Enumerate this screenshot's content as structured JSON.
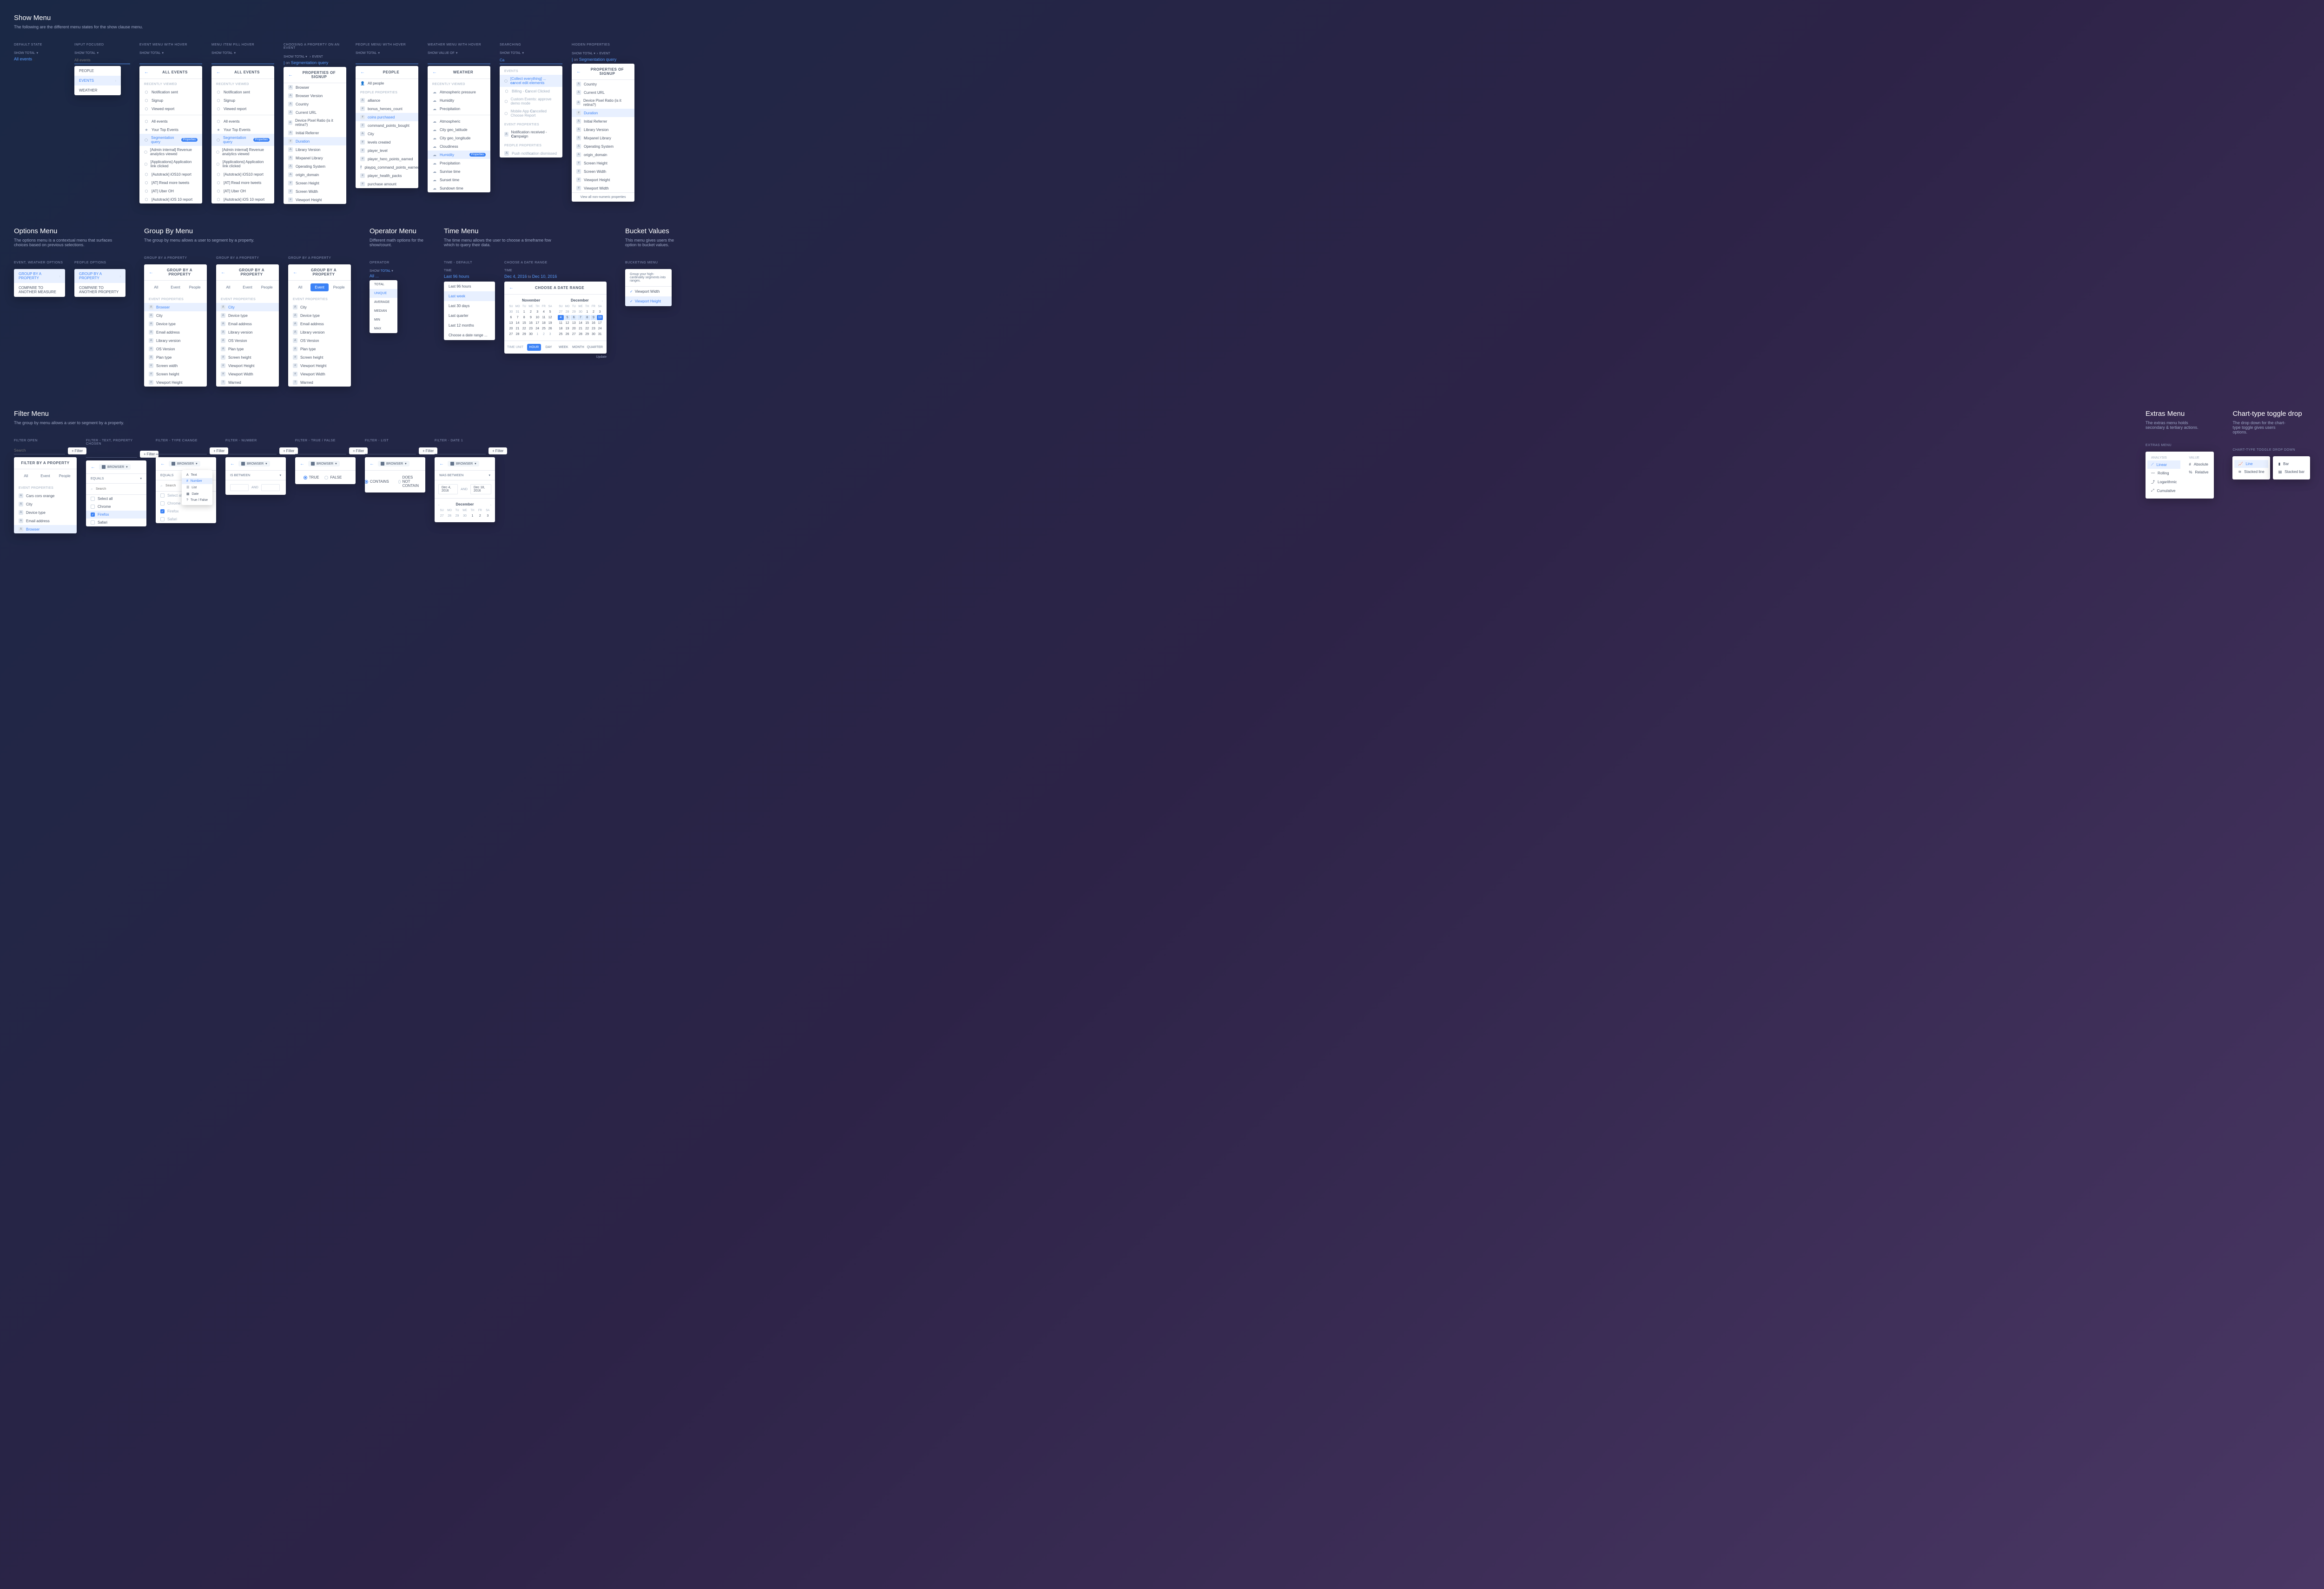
{
  "sections": {
    "show_menu": {
      "title": "Show Menu",
      "desc": "The following are the different menu states for the show clause menu.",
      "variants": {
        "default": "DEFAULT STATE",
        "input_focused": "INPUT FOCUSED",
        "event_hover": "EVENT MENU WITH HOVER",
        "pill_hover": "MENU ITEM PILL HOVER",
        "choosing_prop": "CHOOSING A PROPERTY ON AN EVENT",
        "people_hover": "PEOPLE MENU WITH HOVER",
        "weather_hover": "WEATHER MENU WITH HOVER",
        "searching": "SEARCHING",
        "hidden_props": "HIDDEN PROPERTIES"
      }
    },
    "options_menu": {
      "title": "Options Menu",
      "desc": "The options menu is a contextual menu that surfaces choices based on previous selections.",
      "variants": {
        "event_weather": "EVENT, WEATHER OPTIONS",
        "people": "PEOPLE OPTIONS"
      }
    },
    "group_by": {
      "title": "Group By Menu",
      "desc": "The group by menu allows a user to segment by a property.",
      "variant": "GROUP BY A PROPERTY"
    },
    "operator": {
      "title": "Operator Menu",
      "desc": "Different math options for the show/count.",
      "variant": "OPERATOR"
    },
    "time": {
      "title": "Time Menu",
      "desc": "The time menu allows the user to choose a timeframe fow which to query their data.",
      "variants": {
        "default": "TIME - DEFAULT",
        "range": "CHOOSE A DATE RANGE"
      }
    },
    "bucket": {
      "title": "Bucket Values",
      "desc": "This menu gives users the option to bucket values.",
      "variant": "BUCKETING MENU"
    },
    "filter": {
      "title": "Filter Menu",
      "desc": "The group by menu allows a user to segment by a property.",
      "variants": {
        "open": "FILTER OPEN",
        "text": "FILTER - TEXT, PROPERTY CHOSEN",
        "type_change": "FILTER - TYPE CHANGE",
        "number": "FILTER - NUMBER",
        "bool": "FILTER - TRUE / FALSE",
        "list": "FILTER - LIST",
        "date": "FILTER - DATE 1"
      }
    },
    "extras": {
      "title": "Extras Menu",
      "desc": "The extras menu holds secondary & tertiary actions.",
      "variant": "EXTRAS MENU"
    },
    "chart_toggle": {
      "title": "Chart-type toggle drop",
      "desc": "The drop down for the chart-type toggle gives users options.",
      "variant": "CHART-TYPE TOGGLE DROP DOWN"
    }
  },
  "common": {
    "show_total": "SHOW TOTAL",
    "all_events_link": "All events",
    "search_placeholder": "Search",
    "filter_btn": "Filter",
    "back": "←",
    "event_crumb": "EVENT",
    "on": "on",
    "seg_query": "Segmentation query"
  },
  "people_events_weather": {
    "people": "PEOPLE",
    "events": "EVENTS",
    "weather": "WEATHER"
  },
  "all_events_panel": {
    "title": "ALL EVENTS",
    "recently_viewed": "RECENTLY VIEWED",
    "recent": [
      "Notification sent",
      "Signup",
      "Viewed report"
    ],
    "all_events": "All events",
    "top_events": "Your Top Events",
    "items": [
      "Segmentation query",
      "[Admin internal] Revenue analytics viewed",
      "[Applications] Application link clicked",
      "[Autotrack] iOS10 report",
      "[AT] Read more tweets",
      "[AT] Uber OH",
      "[Autotrack] iOS 10 report"
    ],
    "properties_badge": "Properties"
  },
  "properties_signup": {
    "title": "PROPERTIES OF SIGNUP",
    "items": [
      "Browser",
      "Browser Version",
      "Country",
      "Current URL",
      "Device Pixel Ratio (is it retina?)",
      "Initial Referrer",
      "Duration",
      "Library Version",
      "Mixpanel Library",
      "Operating System",
      "origin_domain",
      "Screen Height",
      "Screen Width",
      "Viewport Height"
    ]
  },
  "people_panel": {
    "title": "PEOPLE",
    "all_people": "All people",
    "section": "PEOPLE PROPERTIES",
    "items": [
      "alliance",
      "bonus_heroes_count",
      "coins purchased",
      "command_points_bought",
      "City",
      "levels created",
      "player_level",
      "player_hero_points_earned",
      "playpq_command_points_earned",
      "player_health_packs",
      "purchase amount"
    ]
  },
  "weather_panel": {
    "title": "WEATHER",
    "show_value_of": "SHOW VALUE OF",
    "recently_viewed": "RECENTLY VIEWED",
    "recent": [
      "Atmospheric pressure",
      "Humidity",
      "Precipitation"
    ],
    "items": [
      "Atmospheric",
      "City geo_latitude",
      "City geo_longitude",
      "Cloudiness",
      "Humidity",
      "Precipitation",
      "Sunrise time",
      "Sunset time",
      "Sundown time"
    ],
    "properties_badge": "Properties"
  },
  "searching_panel": {
    "search_val": "Ca",
    "events_label": "EVENTS",
    "events": [
      {
        "pre": "[Collect everything] ... ",
        "match": "ca",
        "post": "ncel edit elements"
      },
      {
        "pre": "Billing - ",
        "match": "Ca",
        "post": "ncel Clicked",
        "muted": true
      },
      {
        "pre": "Custom Events: ap",
        "match": "",
        "post": "prove demo mode",
        "muted": true
      },
      {
        "pre": "Mobile App ",
        "match": "Ca",
        "post": "ncelled Choose Report",
        "muted": true
      }
    ],
    "event_props_label": "EVENT PROPERTIES",
    "event_props": [
      {
        "pre": "Notification received - ",
        "match": "Ca",
        "post": "mpaign"
      }
    ],
    "people_props_label": "PEOPLE PROPERTIES",
    "people_props": [
      {
        "pre": "Push notifi",
        "match": "ca",
        "post": "tion dismissed",
        "muted": true
      }
    ]
  },
  "hidden_props": {
    "title": "PROPERTIES OF SIGNUP",
    "items": [
      "Country",
      "Current URL",
      "Device Pixel Ratio (is it retina?)",
      "Duration",
      "Initial Referrer",
      "Library Version",
      "Mixpanel Library",
      "Operating System",
      "origin_domain",
      "Screen Height",
      "Screen Width",
      "Viewport Height",
      "Viewport Width"
    ],
    "view_all": "View all non-numeric properties"
  },
  "options_panel": {
    "group_by": "GROUP BY A PROPERTY",
    "compare_measure": "COMPARE TO ANOTHER MEASURE",
    "compare_property": "COMPARE TO ANOTHER PROPERTY"
  },
  "group_by_panel": {
    "title": "GROUP BY A PROPERTY",
    "tabs": [
      "All",
      "Event",
      "People"
    ],
    "section": "EVENT PROPERTIES",
    "items": [
      "Browser",
      "City",
      "Device type",
      "Email address",
      "Library version",
      "OS Version",
      "Plan type",
      "Screen width",
      "Screen height",
      "Viewport Height",
      "Viewport Width",
      "Warned"
    ]
  },
  "operator_panel": {
    "show": "SHOW",
    "total": "TOTAL",
    "link": "All ...",
    "items": [
      "TOTAL",
      "UNIQUE",
      "AVERAGE",
      "MEDIAN",
      "MIN",
      "MAX"
    ]
  },
  "time_panel": {
    "time_label": "TIME",
    "current": "Last 96 hours",
    "items": [
      "Last 96 hours",
      "Last week",
      "Last 30 days",
      "Last quarter",
      "Last 12 months",
      "Choose a date range ..."
    ]
  },
  "date_range": {
    "from": "Dec 4, 2016",
    "to": "Dec 10, 2016",
    "title": "CHOOSE A DATE RANGE",
    "months": [
      "November",
      "December"
    ],
    "dow": [
      "SU",
      "MO",
      "TU",
      "WE",
      "TH",
      "FR",
      "SA"
    ],
    "time_unit_label": "TIME UNIT",
    "units": [
      "HOUR",
      "DAY",
      "WEEK",
      "MONTH",
      "QUARTER"
    ],
    "update": "Update"
  },
  "bucket_panel": {
    "desc": "Group your high-cardinality segments into ranges.",
    "items": [
      "Viewport Width",
      "Viewport Height"
    ]
  },
  "filter_open_panel": {
    "title": "FILTER BY A PROPERTY",
    "tabs": [
      "All",
      "Event",
      "People"
    ],
    "section": "EVENT PROPERTIES",
    "items": [
      "Cars cors orange",
      "City",
      "Device type",
      "Email address",
      "Browser"
    ]
  },
  "filter_text": {
    "browser": "BROWSER",
    "equals": "EQUALS",
    "search": "Search",
    "select_all": "Select all",
    "items": [
      "Chrome",
      "Firefox",
      "Safari"
    ]
  },
  "filter_type": {
    "types": [
      "Text",
      "Number",
      "List",
      "Date",
      "True / False"
    ]
  },
  "filter_number": {
    "between": "IS BETWEEN",
    "and": "AND"
  },
  "filter_bool": {
    "true": "TRUE",
    "false": "FALSE"
  },
  "filter_list": {
    "contains": "CONTAINS",
    "not_contains": "DOES NOT CONTAIN"
  },
  "filter_date": {
    "was_between": "WAS BETWEEN",
    "d1": "Dec 4, 2016",
    "d2": "Dec 18, 2016",
    "month": "December"
  },
  "extras_panel": {
    "analysis": "ANALYSIS",
    "value": "VALUE",
    "analysis_items": [
      "Linear",
      "Rolling",
      "Logarithmic",
      "Cumulative"
    ],
    "value_items": [
      "Absolute",
      "Relative"
    ]
  },
  "chart_toggle_panel": {
    "col1": [
      "Line",
      "Stacked line"
    ],
    "col2": [
      "Bar",
      "Stacked bar"
    ]
  }
}
